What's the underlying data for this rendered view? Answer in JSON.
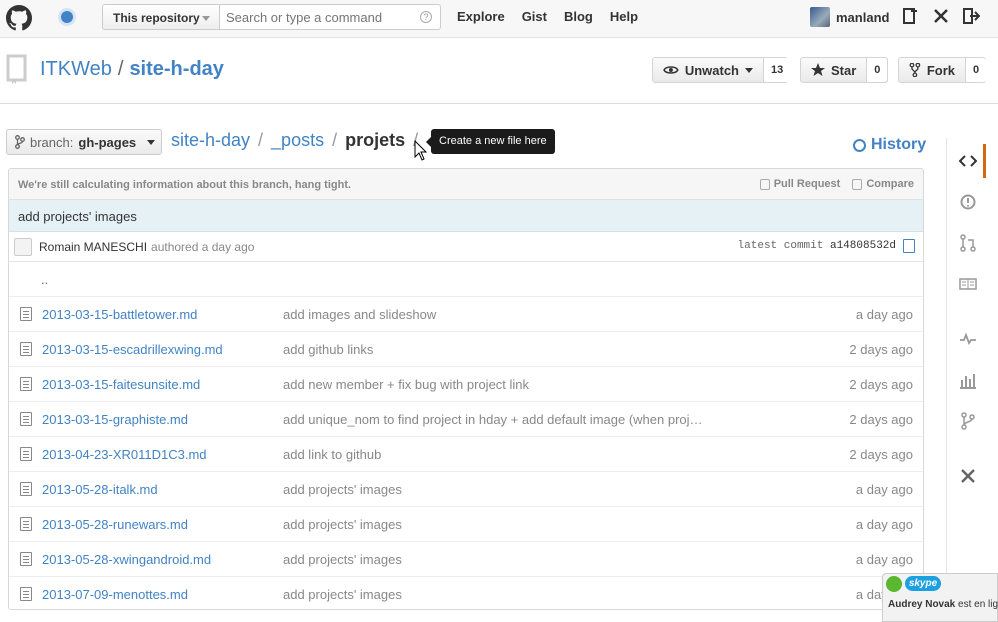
{
  "header": {
    "scope_label": "This repository",
    "search_placeholder": "Search or type a command",
    "help_label": "?",
    "nav": [
      "Explore",
      "Gist",
      "Blog",
      "Help"
    ],
    "username": "manland"
  },
  "repo": {
    "owner": "ITKWeb",
    "separator": "/",
    "name": "site-h-day",
    "unwatch_label": "Unwatch",
    "watch_count": "13",
    "star_label": "Star",
    "star_count": "0",
    "fork_label": "Fork",
    "fork_count": "0"
  },
  "branch": {
    "prefix": "branch:",
    "name": "gh-pages"
  },
  "breadcrumb": {
    "root": "site-h-day",
    "sep": "/",
    "middle": "_posts",
    "current": "projets"
  },
  "tooltip": "Create a new file here",
  "history_label": "History",
  "browser": {
    "calc_message": "We're still calculating information about this branch, hang tight.",
    "pull_request_label": "Pull Request",
    "compare_label": "Compare",
    "commit_message": "add projects' images",
    "author": "Romain MANESCHI",
    "authored": "authored a day ago",
    "latest_commit_label": "latest commit",
    "sha": "a14808532d",
    "parent_dir": "..",
    "files": [
      {
        "name": "2013-03-15-battletower.md",
        "message": "add images and slideshow",
        "age": "a day ago"
      },
      {
        "name": "2013-03-15-escadrillexwing.md",
        "message": "add github links",
        "age": "2 days ago"
      },
      {
        "name": "2013-03-15-faitesunsite.md",
        "message": "add new member + fix bug with project link",
        "age": "2 days ago"
      },
      {
        "name": "2013-03-15-graphiste.md",
        "message": "add unique_nom to find project in hday + add default image (when proj…",
        "age": "2 days ago"
      },
      {
        "name": "2013-04-23-XR011D1C3.md",
        "message": "add link to github",
        "age": "2 days ago"
      },
      {
        "name": "2013-05-28-italk.md",
        "message": "add projects' images",
        "age": "a day ago"
      },
      {
        "name": "2013-05-28-runewars.md",
        "message": "add projects' images",
        "age": "a day ago"
      },
      {
        "name": "2013-05-28-xwingandroid.md",
        "message": "add projects' images",
        "age": "a day ago"
      },
      {
        "name": "2013-07-09-menottes.md",
        "message": "add projects' images",
        "age": "a day ago"
      }
    ]
  },
  "skype": {
    "brand": "skype",
    "contact": "Audrey Novak",
    "status": "est en lig"
  }
}
